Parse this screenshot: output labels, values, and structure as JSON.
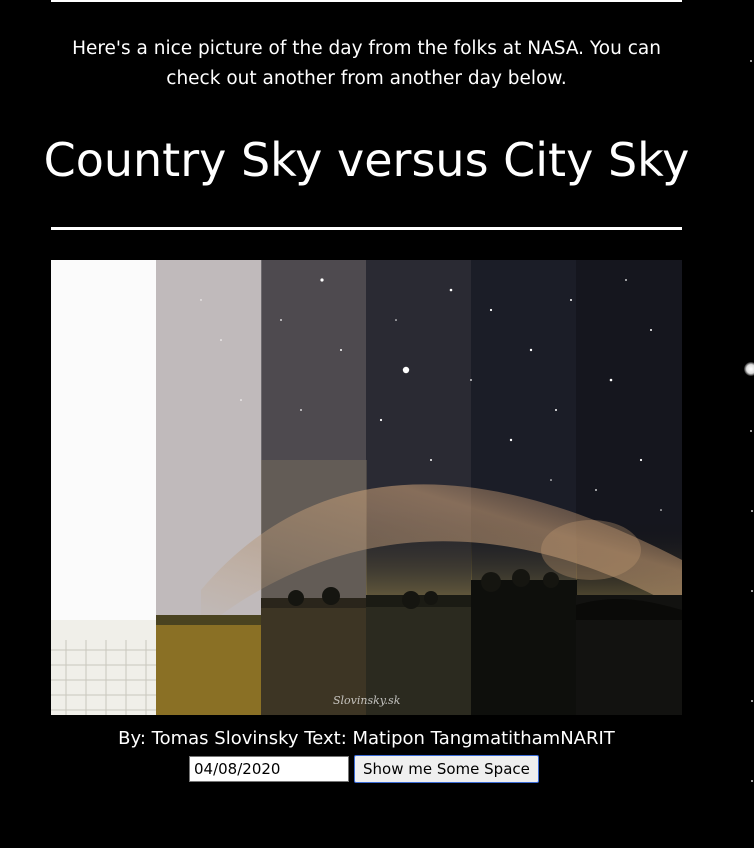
{
  "intro": {
    "text": "Here's a nice picture of the day from the folks at NASA. You can check out another from another day below."
  },
  "apod": {
    "title": "Country Sky versus City Sky",
    "image_alt": "Country Sky versus City Sky",
    "watermark": "Slovinsky.sk",
    "credit": "By: Tomas Slovinsky Text: Matipon TangmatithamNARIT"
  },
  "date_picker": {
    "value": "04/08/2020",
    "button_label": "Show me Some Space"
  },
  "colors": {
    "background": "#000000",
    "text": "#ffffff",
    "rule": "#ffffff",
    "button_border": "#3b6bd6"
  }
}
